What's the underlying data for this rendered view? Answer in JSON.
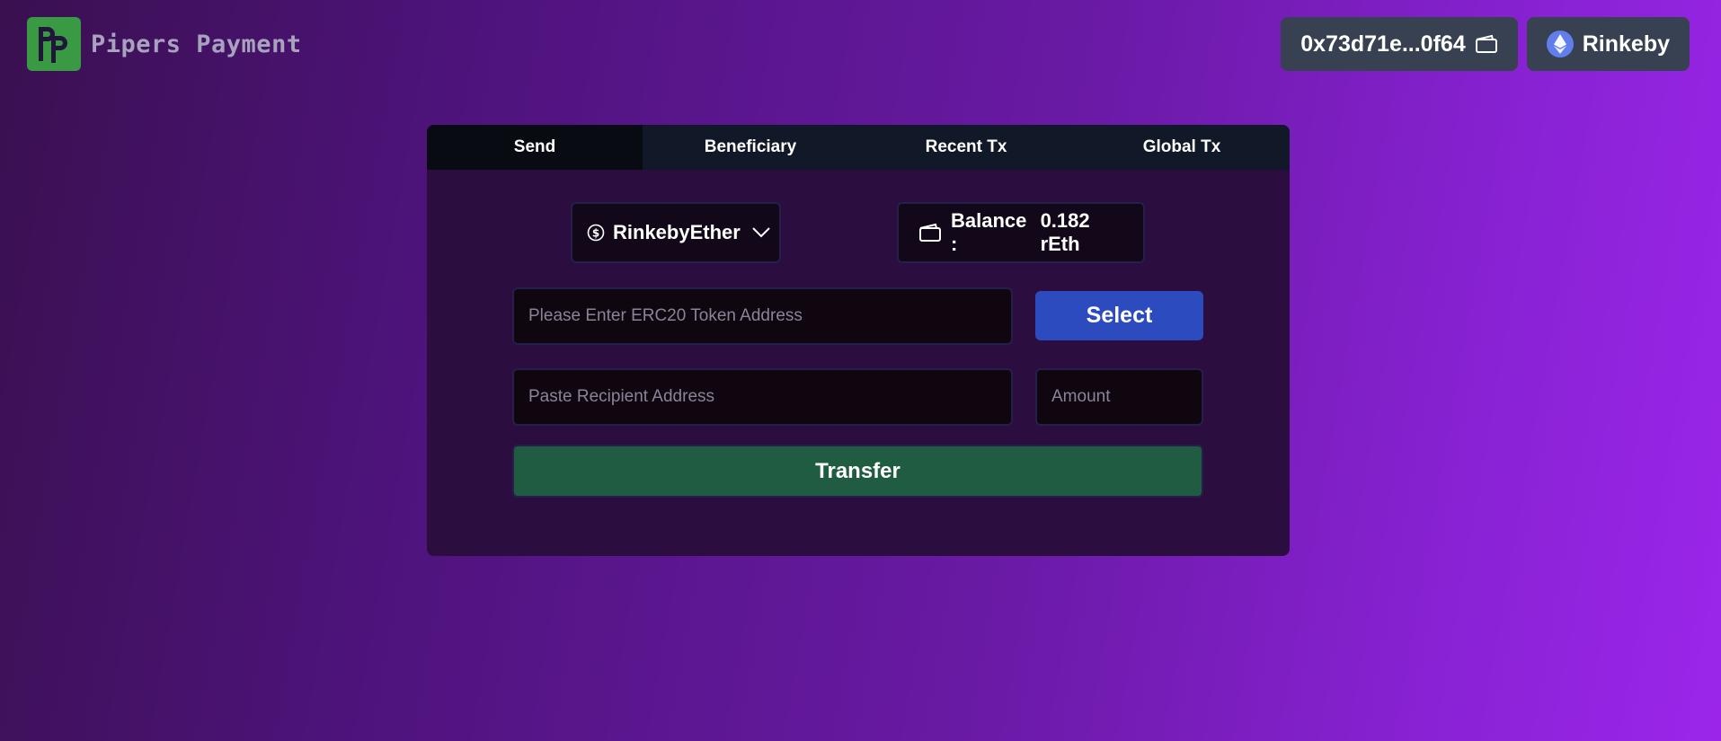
{
  "brand": {
    "name": "Pipers Payment",
    "logo_icon": "pp-logo-icon",
    "logo_color": "#3a9a44"
  },
  "header": {
    "account": "0x73d71e...0f64",
    "account_icon": "wallet-icon",
    "network": "Rinkeby",
    "network_icon": "ethereum-icon"
  },
  "tabs": [
    {
      "label": "Send",
      "active": true
    },
    {
      "label": "Beneficiary",
      "active": false
    },
    {
      "label": "Recent Tx",
      "active": false
    },
    {
      "label": "Global Tx",
      "active": false
    }
  ],
  "send": {
    "token": "RinkebyEther",
    "token_icon": "dollar-coin-icon",
    "balance_label": "Balance :",
    "balance_value": "0.182 rEth",
    "balance_icon": "wallet-icon",
    "token_address_placeholder": "Please Enter ERC20 Token Address",
    "token_address_value": "",
    "select_label": "Select",
    "recipient_placeholder": "Paste Recipient Address",
    "recipient_value": "",
    "amount_placeholder": "Amount",
    "amount_value": "",
    "transfer_label": "Transfer"
  },
  "colors": {
    "select_button": "#2b4bbf",
    "transfer_button": "#1f5c42",
    "card_bg": "#2b0d3f",
    "tab_bar": "#111827",
    "header_pill": "#374151"
  }
}
